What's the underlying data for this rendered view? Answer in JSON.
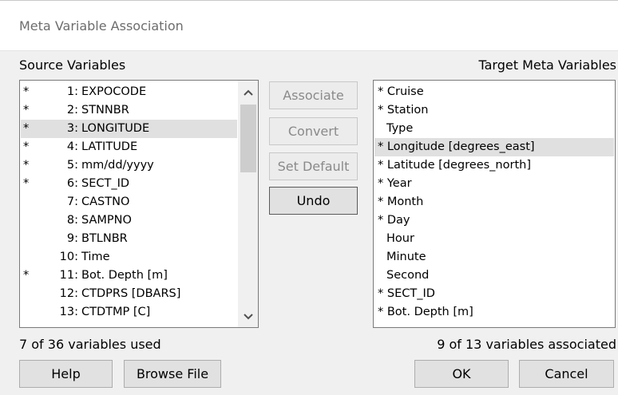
{
  "window": {
    "title": "Meta Variable Association"
  },
  "source": {
    "label": "Source Variables",
    "items": [
      {
        "mark": "*",
        "text": "1: EXPOCODE"
      },
      {
        "mark": "*",
        "text": "2: STNNBR"
      },
      {
        "mark": "*",
        "text": "3: LONGITUDE"
      },
      {
        "mark": "*",
        "text": "4: LATITUDE"
      },
      {
        "mark": "*",
        "text": "5: mm/dd/yyyy"
      },
      {
        "mark": "*",
        "text": "6: SECT_ID"
      },
      {
        "mark": "",
        "text": "7: CASTNO"
      },
      {
        "mark": "",
        "text": "8: SAMPNO"
      },
      {
        "mark": "",
        "text": "9: BTLNBR"
      },
      {
        "mark": "",
        "text": "10: Time"
      },
      {
        "mark": "*",
        "text": "11: Bot. Depth [m]"
      },
      {
        "mark": "",
        "text": "12: CTDPRS [DBARS]"
      },
      {
        "mark": "",
        "text": "13: CTDTMP [C]"
      }
    ],
    "selected_index": 2,
    "status": "7 of 36 variables used"
  },
  "target": {
    "label": "Target Meta Variables",
    "items": [
      "* Cruise",
      "* Station",
      "Type",
      "* Longitude [degrees_east]",
      "* Latitude [degrees_north]",
      "* Year",
      "* Month",
      "* Day",
      "Hour",
      "Minute",
      "Second",
      "* SECT_ID",
      "* Bot. Depth [m]"
    ],
    "selected_index": 3,
    "status": "9 of 13 variables associated"
  },
  "actions": {
    "associate": "Associate",
    "convert": "Convert",
    "set_default": "Set Default",
    "undo": "Undo"
  },
  "footer": {
    "help": "Help",
    "browse": "Browse File",
    "ok": "OK",
    "cancel": "Cancel"
  },
  "colors": {
    "selected_row": "#e0e0e0",
    "disabled_text": "#8a8a8a",
    "title_text": "#6d6d6d"
  }
}
